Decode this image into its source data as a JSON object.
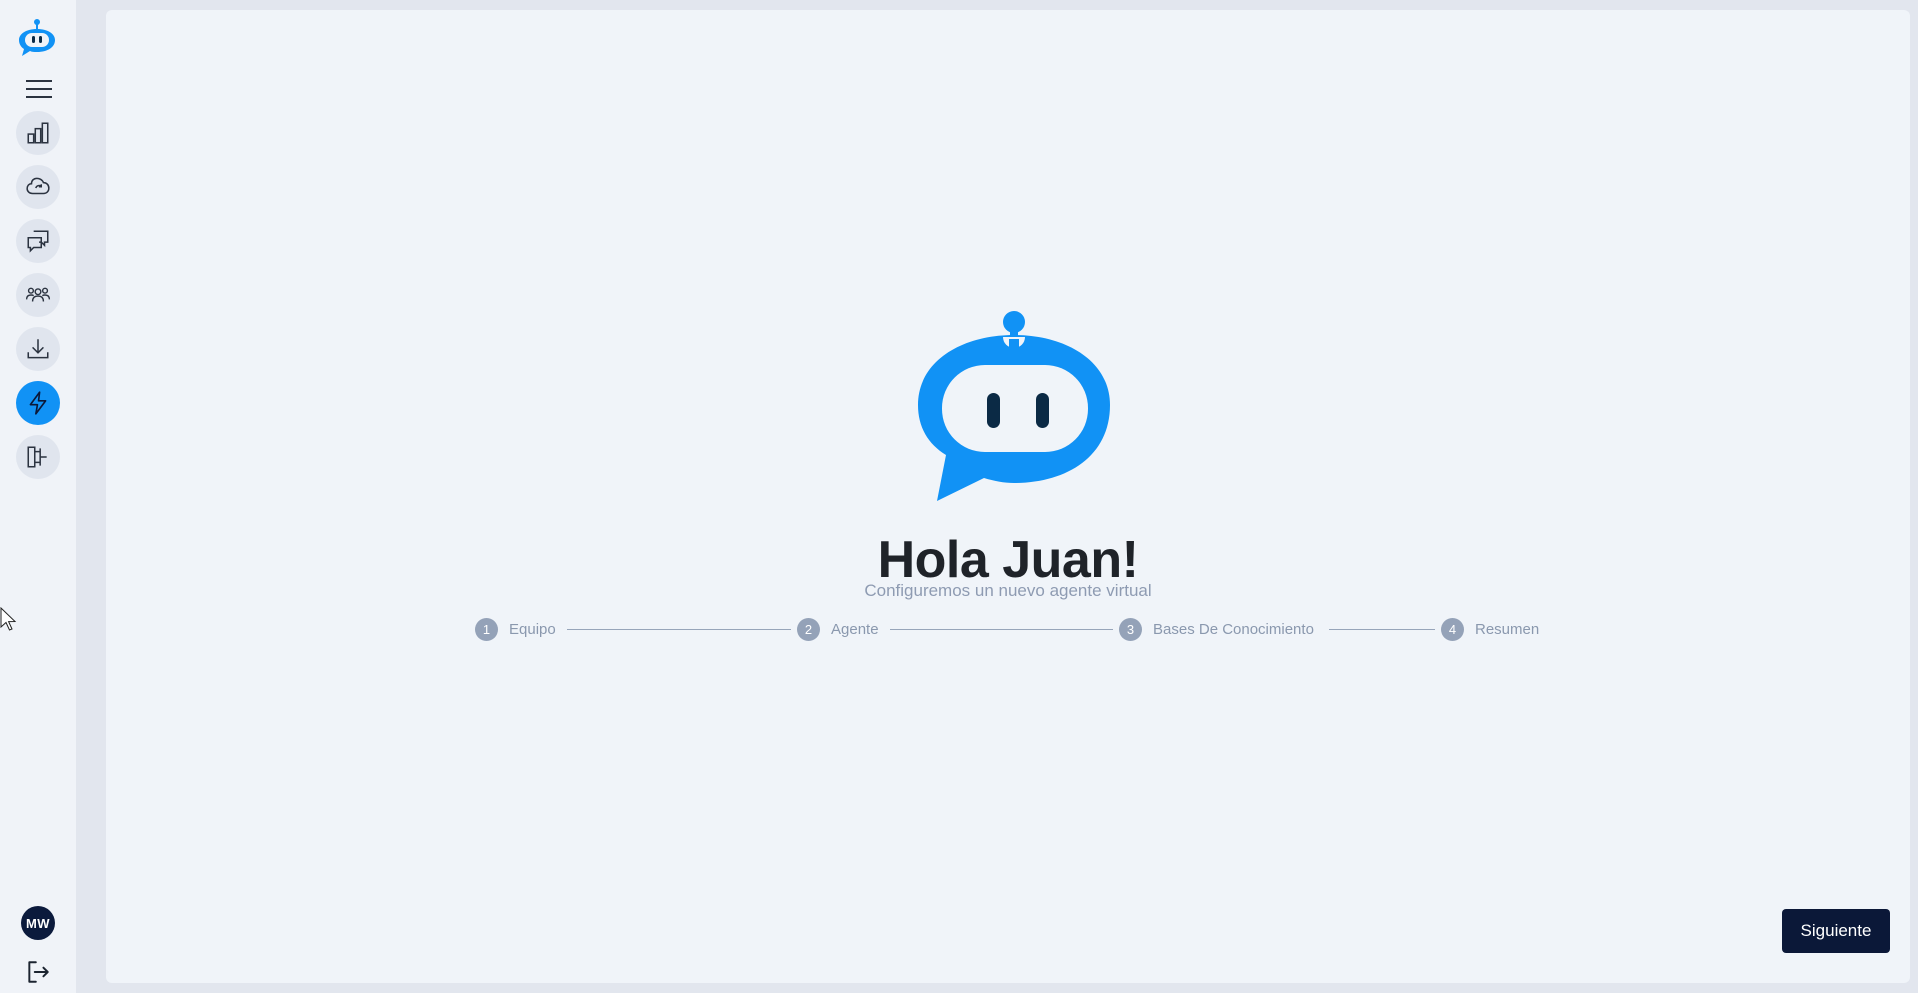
{
  "sidebar": {
    "logo_icon": "chatbot-logo-icon",
    "menu_icon": "hamburger-menu-icon",
    "items": [
      {
        "icon": "bar-chart-icon"
      },
      {
        "icon": "cloud-sync-icon"
      },
      {
        "icon": "chat-bubbles-icon"
      },
      {
        "icon": "users-group-icon"
      },
      {
        "icon": "download-icon"
      },
      {
        "icon": "lightning-bolt-icon",
        "active": true
      },
      {
        "icon": "flow-diagram-icon"
      }
    ],
    "user_initials": "MW",
    "logout_icon": "logout-icon"
  },
  "main": {
    "greeting": "Hola Juan!",
    "subtitle": "Configuremos un nuevo agente virtual",
    "steps": [
      {
        "number": "1",
        "label": "Equipo"
      },
      {
        "number": "2",
        "label": "Agente"
      },
      {
        "number": "3",
        "label": "Bases De Conocimiento"
      },
      {
        "number": "4",
        "label": "Resumen"
      }
    ],
    "next_button": "Siguiente"
  },
  "colors": {
    "accent": "#1192f5",
    "dark": "#0b1838",
    "step_badge": "#94a2b8"
  }
}
